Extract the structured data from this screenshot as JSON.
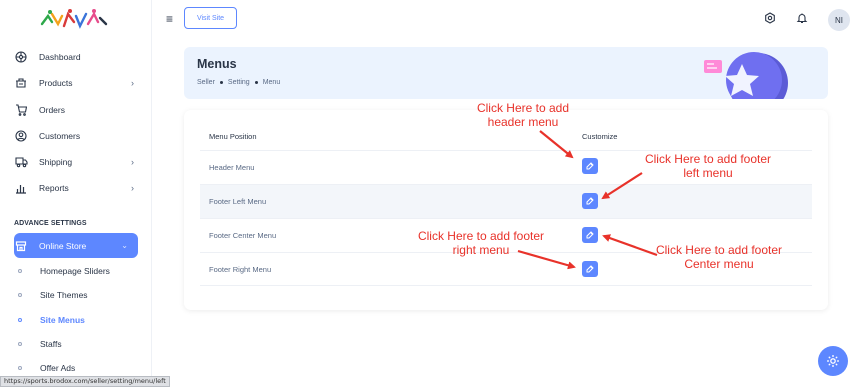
{
  "sidebar": {
    "nav": [
      {
        "label": "Dashboard",
        "icon": "dashboard-icon",
        "has_chevron": false
      },
      {
        "label": "Products",
        "icon": "products-icon",
        "has_chevron": true
      },
      {
        "label": "Orders",
        "icon": "cart-icon",
        "has_chevron": false
      },
      {
        "label": "Customers",
        "icon": "user-circle-icon",
        "has_chevron": false
      },
      {
        "label": "Shipping",
        "icon": "truck-icon",
        "has_chevron": true
      },
      {
        "label": "Reports",
        "icon": "bar-chart-icon",
        "has_chevron": true
      }
    ],
    "section_label": "ADVANCE SETTINGS",
    "active_group": {
      "label": "Online Store",
      "icon": "store-icon"
    },
    "sub_items": [
      {
        "label": "Homepage Sliders"
      },
      {
        "label": "Site Themes"
      },
      {
        "label": "Site Menus",
        "active": true
      },
      {
        "label": "Staffs"
      },
      {
        "label": "Offer Ads"
      }
    ]
  },
  "topbar": {
    "visit_site_label": "Visit Site",
    "avatar_initials": "NI"
  },
  "banner": {
    "title": "Menus",
    "breadcrumb": [
      "Seller",
      "Setting",
      "Menu"
    ]
  },
  "table": {
    "headers": {
      "position": "Menu Position",
      "customize": "Customize"
    },
    "rows": [
      {
        "label": "Header Menu"
      },
      {
        "label": "Footer Left Menu"
      },
      {
        "label": "Footer Center Menu"
      },
      {
        "label": "Footer Right Menu"
      }
    ]
  },
  "annotations": {
    "header": [
      "Click Here to add",
      "header menu"
    ],
    "footer_left": [
      "Click Here to add footer",
      "left menu"
    ],
    "footer_right": [
      "Click Here to add footer",
      "right menu"
    ],
    "footer_center": [
      "Click Here to add footer",
      "Center menu"
    ]
  },
  "status_url": "https://sports.brodox.com/seller/setting/menu/left",
  "colors": {
    "accent": "#5d87ff",
    "annotation": "#e8322a",
    "banner_bg": "#ebf3fe"
  }
}
